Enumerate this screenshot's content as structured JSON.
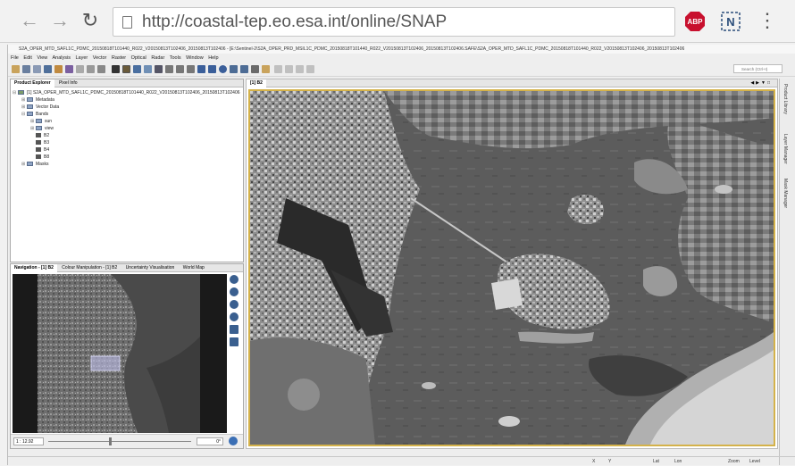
{
  "browser": {
    "url": "http://coastal-tep.eo.esa.int/online/SNAP",
    "abp_label": "ABP",
    "ext2_label": "N"
  },
  "app": {
    "title": "S2A_OPER_MTD_SAFL1C_PDMC_20150818T101440_R022_V20150813T102406_20150813T102406 - [E:\\Sentinel-2\\S2A_OPER_PRD_MSIL1C_PDMC_20150818T101440_R022_V20150813T102406_20150813T102406.SAFE\\S2A_OPER_MTD_SAFL1C_PDMC_20150818T101440_R022_V20150813T102406_20150813T102406",
    "menu": [
      "File",
      "Edit",
      "View",
      "Analysis",
      "Layer",
      "Vector",
      "Raster",
      "Optical",
      "Radar",
      "Tools",
      "Window",
      "Help"
    ],
    "search_placeholder": "Search (Ctrl+I)"
  },
  "product_explorer": {
    "tabs": [
      "Product Explorer",
      "Pixel Info"
    ],
    "product": "[1] S2A_OPER_MTD_SAFL1C_PDMC_20150818T101440_R022_V20150813T102406_20150813T102406",
    "nodes": [
      "Metadata",
      "Vector Data",
      "Bands",
      "sun",
      "view",
      "B2",
      "B3",
      "B4",
      "B8",
      "Masks"
    ]
  },
  "image_view": {
    "tab": "[1] B2"
  },
  "navigation": {
    "tabs": [
      "Navigation - [1] B2",
      "Colour Manipulation - [1] B2",
      "Uncertainty Visualisation",
      "World Map"
    ],
    "zoom": "1 : 12.92",
    "angle": "0°"
  },
  "right_tabs": [
    "Product Library",
    "Layer Manager",
    "Mask Manager"
  ],
  "status": {
    "x": "X",
    "y": "Y",
    "lat": "Lat",
    "lon": "Lon",
    "zoom": "Zoom",
    "level": "Level"
  }
}
